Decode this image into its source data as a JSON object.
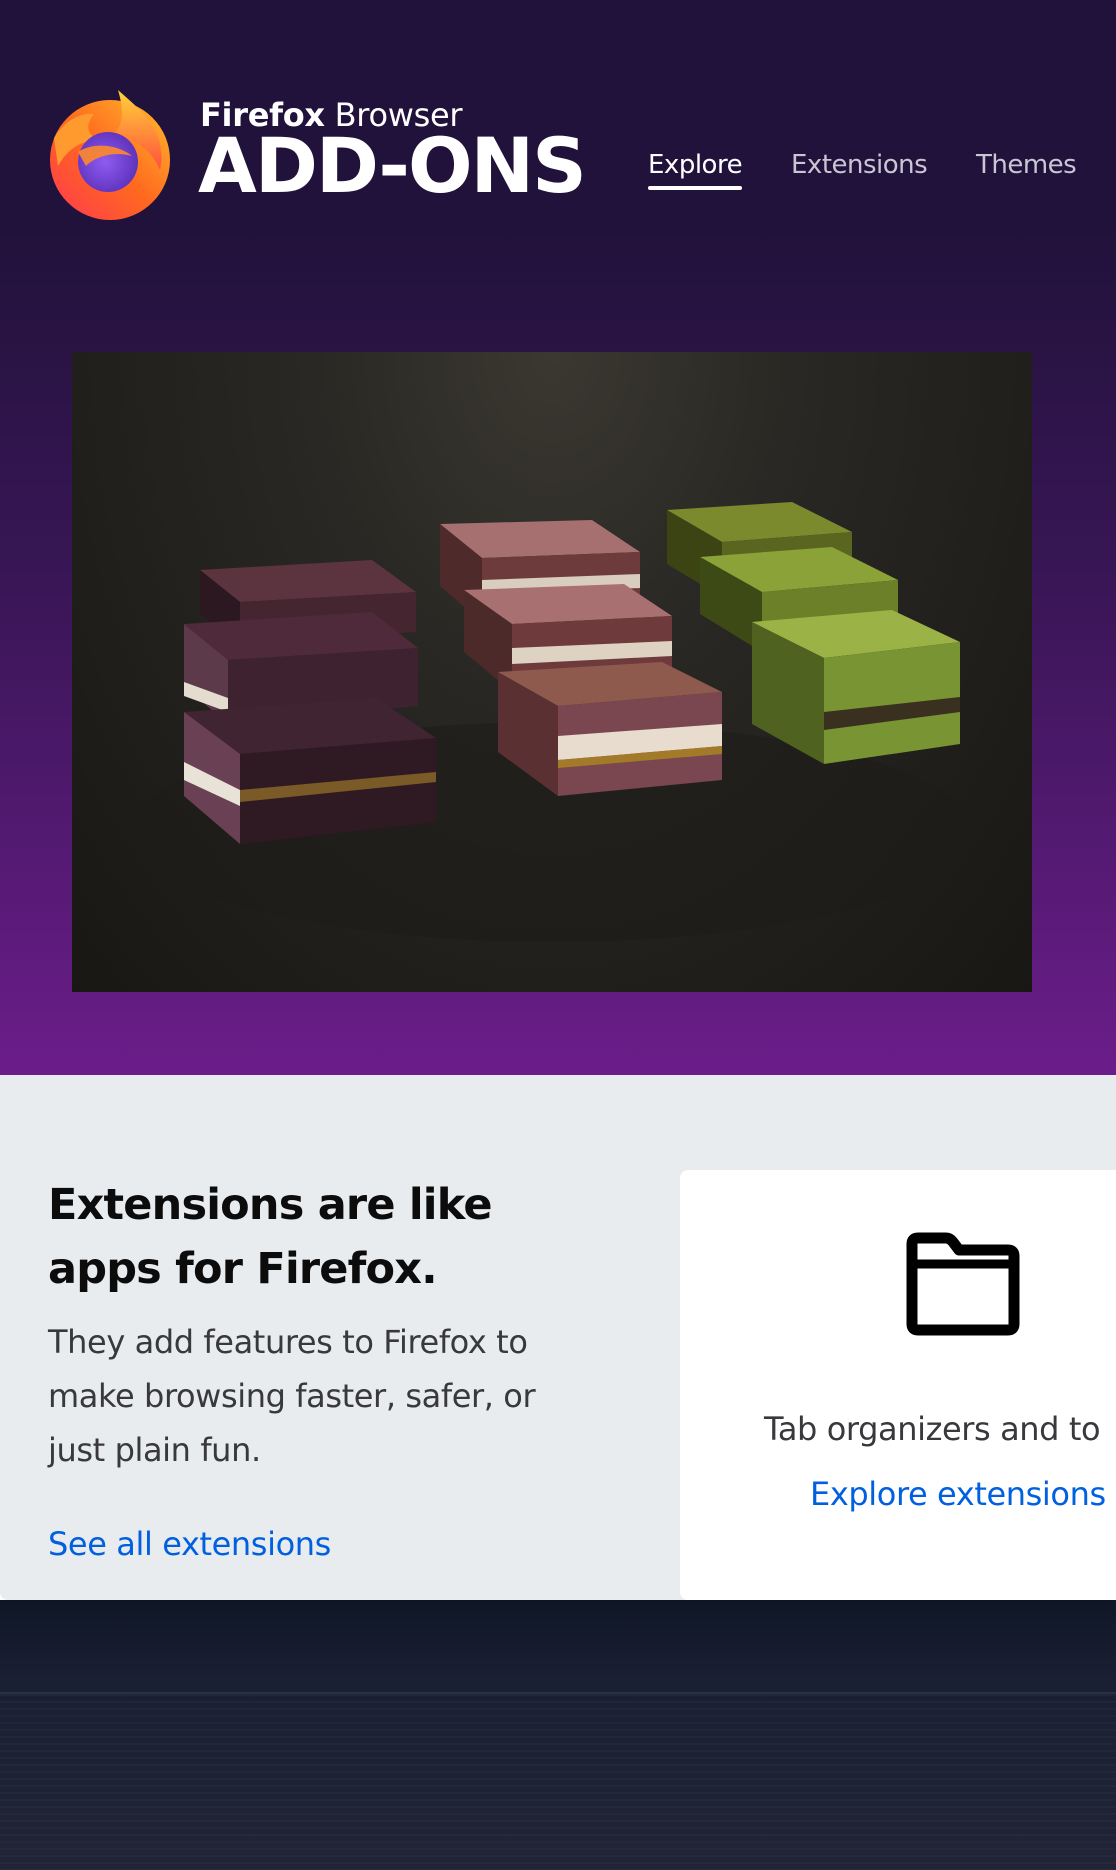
{
  "header": {
    "logo": {
      "kicker_bold": "Firefox",
      "kicker_rest": " Browser",
      "title": "ADD-ONS",
      "icon": "firefox-logo-icon"
    },
    "nav": [
      {
        "label": "Explore",
        "active": true
      },
      {
        "label": "Extensions",
        "active": false
      },
      {
        "label": "Themes",
        "active": false
      }
    ]
  },
  "hero": {
    "image": "photo-of-layered-fudge-squares",
    "colors": {
      "top": "#20123a",
      "bottom": "#6b1d8a"
    }
  },
  "extensions_promo": {
    "title": "Extensions are like apps for Firefox.",
    "text": "They add features to Firefox to make browsing faster, safer, or just plain fun.",
    "link": "See all extensions",
    "card": {
      "icon": "folder-icon",
      "text": "Tab organizers and to",
      "link": "Explore extensions"
    }
  },
  "colors": {
    "link": "#0060df",
    "band": "#e9ecef",
    "heading": "#0c0c0d"
  }
}
